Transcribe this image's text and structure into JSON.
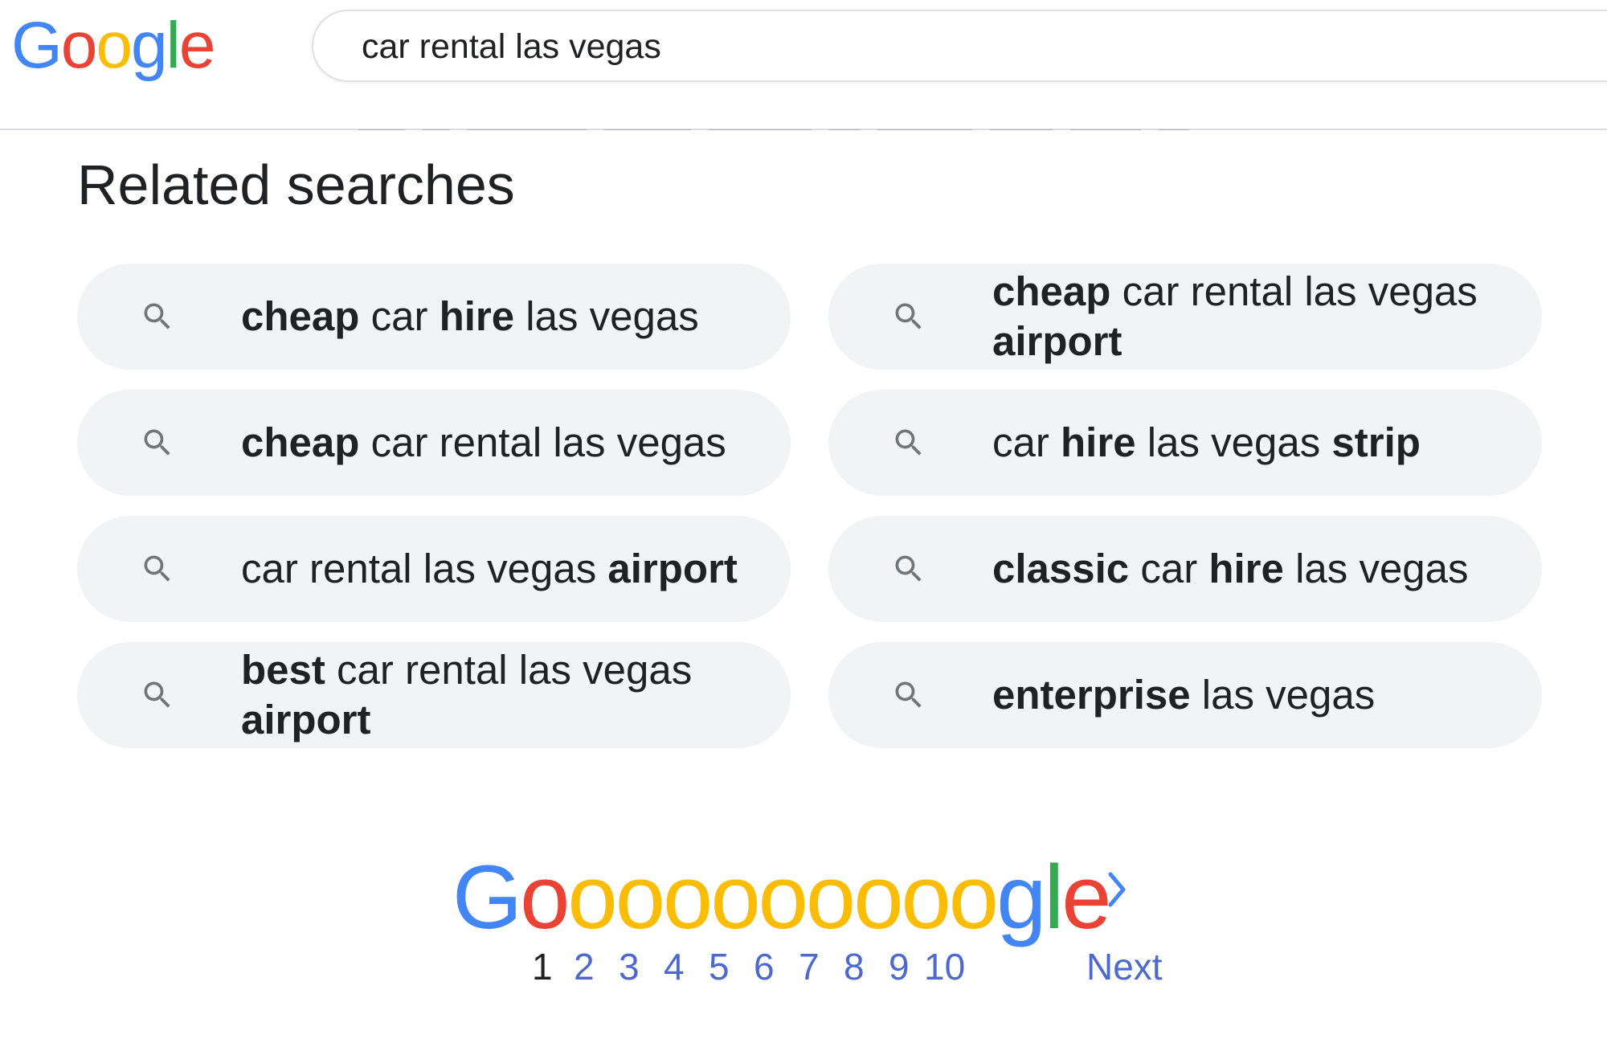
{
  "header": {
    "logo_letters": [
      "G",
      "o",
      "o",
      "g",
      "l",
      "e"
    ],
    "search_value": "car rental las vegas"
  },
  "related": {
    "title": "Related searches",
    "items": [
      {
        "parts": [
          {
            "t": "cheap",
            "b": true
          },
          {
            "t": " car ",
            "b": false
          },
          {
            "t": "hire",
            "b": true
          },
          {
            "t": " las vegas",
            "b": false
          }
        ]
      },
      {
        "parts": [
          {
            "t": "cheap",
            "b": true
          },
          {
            "t": " car rental las vegas ",
            "b": false
          },
          {
            "t": "airport",
            "b": true
          }
        ]
      },
      {
        "parts": [
          {
            "t": "cheap",
            "b": true
          },
          {
            "t": " car rental las vegas",
            "b": false
          }
        ]
      },
      {
        "parts": [
          {
            "t": "car ",
            "b": false
          },
          {
            "t": "hire",
            "b": true
          },
          {
            "t": " las vegas ",
            "b": false
          },
          {
            "t": "strip",
            "b": true
          }
        ]
      },
      {
        "parts": [
          {
            "t": "car rental las vegas ",
            "b": false
          },
          {
            "t": "airport",
            "b": true
          }
        ]
      },
      {
        "parts": [
          {
            "t": "classic",
            "b": true
          },
          {
            "t": " car ",
            "b": false
          },
          {
            "t": "hire",
            "b": true
          },
          {
            "t": " las vegas",
            "b": false
          }
        ]
      },
      {
        "parts": [
          {
            "t": "best",
            "b": true
          },
          {
            "t": " car rental las vegas ",
            "b": false
          },
          {
            "t": "airport",
            "b": true
          }
        ]
      },
      {
        "parts": [
          {
            "t": "enterprise",
            "b": true
          },
          {
            "t": " las vegas",
            "b": false
          }
        ]
      }
    ]
  },
  "pagination": {
    "logo_letters": [
      "G",
      "o",
      "o",
      "o",
      "o",
      "o",
      "o",
      "o",
      "o",
      "o",
      "o",
      "g",
      "l",
      "e"
    ],
    "current": "1",
    "pages": [
      "2",
      "3",
      "4",
      "5",
      "6",
      "7",
      "8",
      "9",
      "10"
    ],
    "next_label": "Next"
  },
  "colors": {
    "blue": "#4285f4",
    "red": "#ea4335",
    "yellow": "#fbbc05",
    "green": "#34a853",
    "link": "#4c69cd",
    "chip_bg": "#f1f3f4"
  }
}
